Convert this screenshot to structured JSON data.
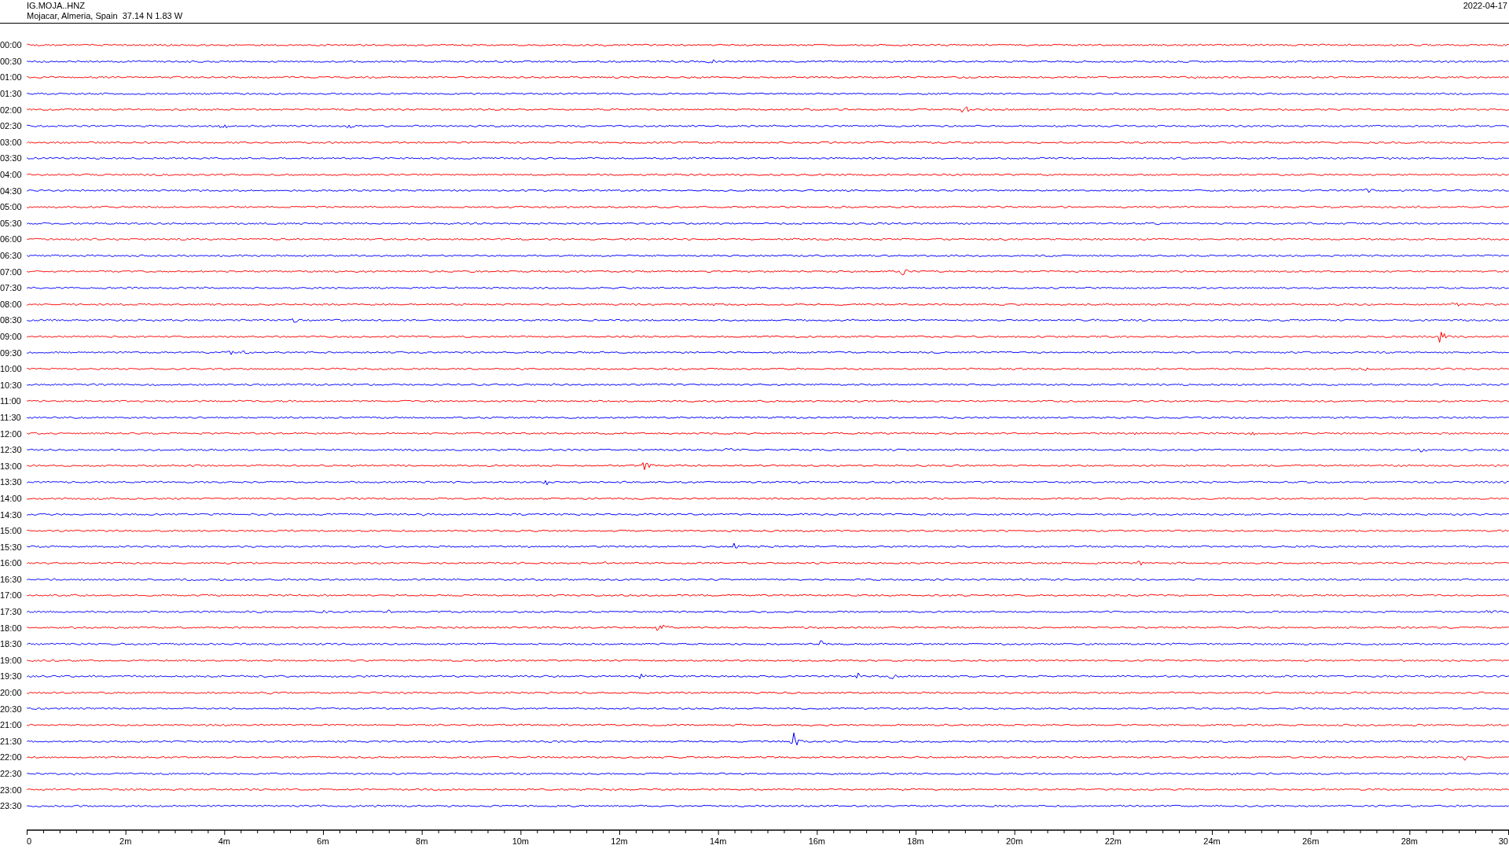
{
  "header": {
    "station": "IG.MOJA..HNZ",
    "location": "Mojacar, Almeria, Spain  37.14 N 1.83 W",
    "date": "2022-04-17"
  },
  "rows": [
    {
      "label": "00:00",
      "color": "#ff0000"
    },
    {
      "label": "00:30",
      "color": "#0000ff"
    },
    {
      "label": "01:00",
      "color": "#ff0000"
    },
    {
      "label": "01:30",
      "color": "#0000ff"
    },
    {
      "label": "02:00",
      "color": "#ff0000"
    },
    {
      "label": "02:30",
      "color": "#0000ff"
    },
    {
      "label": "03:00",
      "color": "#ff0000"
    },
    {
      "label": "03:30",
      "color": "#0000ff"
    },
    {
      "label": "04:00",
      "color": "#ff0000"
    },
    {
      "label": "04:30",
      "color": "#0000ff"
    },
    {
      "label": "05:00",
      "color": "#ff0000"
    },
    {
      "label": "05:30",
      "color": "#0000ff"
    },
    {
      "label": "06:00",
      "color": "#ff0000"
    },
    {
      "label": "06:30",
      "color": "#0000ff"
    },
    {
      "label": "07:00",
      "color": "#ff0000"
    },
    {
      "label": "07:30",
      "color": "#0000ff"
    },
    {
      "label": "08:00",
      "color": "#ff0000"
    },
    {
      "label": "08:30",
      "color": "#0000ff"
    },
    {
      "label": "09:00",
      "color": "#ff0000"
    },
    {
      "label": "09:30",
      "color": "#0000ff"
    },
    {
      "label": "10:00",
      "color": "#ff0000"
    },
    {
      "label": "10:30",
      "color": "#0000ff"
    },
    {
      "label": "11:00",
      "color": "#ff0000"
    },
    {
      "label": "11:30",
      "color": "#0000ff"
    },
    {
      "label": "12:00",
      "color": "#ff0000"
    },
    {
      "label": "12:30",
      "color": "#0000ff"
    },
    {
      "label": "13:00",
      "color": "#ff0000"
    },
    {
      "label": "13:30",
      "color": "#0000ff"
    },
    {
      "label": "14:00",
      "color": "#ff0000"
    },
    {
      "label": "14:30",
      "color": "#0000ff"
    },
    {
      "label": "15:00",
      "color": "#ff0000"
    },
    {
      "label": "15:30",
      "color": "#0000ff"
    },
    {
      "label": "16:00",
      "color": "#ff0000"
    },
    {
      "label": "16:30",
      "color": "#0000ff"
    },
    {
      "label": "17:00",
      "color": "#ff0000"
    },
    {
      "label": "17:30",
      "color": "#0000ff"
    },
    {
      "label": "18:00",
      "color": "#ff0000"
    },
    {
      "label": "18:30",
      "color": "#0000ff"
    },
    {
      "label": "19:00",
      "color": "#ff0000"
    },
    {
      "label": "19:30",
      "color": "#0000ff"
    },
    {
      "label": "20:00",
      "color": "#ff0000"
    },
    {
      "label": "20:30",
      "color": "#0000ff"
    },
    {
      "label": "21:00",
      "color": "#ff0000"
    },
    {
      "label": "21:30",
      "color": "#0000ff"
    },
    {
      "label": "22:00",
      "color": "#ff0000"
    },
    {
      "label": "22:30",
      "color": "#0000ff"
    },
    {
      "label": "23:00",
      "color": "#ff0000"
    },
    {
      "label": "23:30",
      "color": "#0000ff"
    }
  ],
  "axis": {
    "labels": [
      "0",
      "2m",
      "4m",
      "6m",
      "8m",
      "10m",
      "12m",
      "14m",
      "16m",
      "18m",
      "20m",
      "22m",
      "24m",
      "26m",
      "28m",
      "30"
    ]
  }
}
